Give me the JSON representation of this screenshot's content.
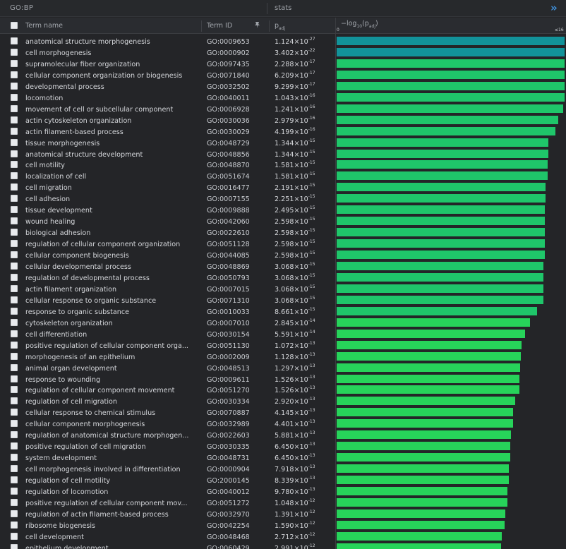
{
  "header": {
    "source": "GO:BP",
    "stats_label": "stats",
    "expand_glyph": "»"
  },
  "columns": {
    "term_name": "Term name",
    "term_id": "Term ID",
    "padj": "p",
    "padj_sub": "adj",
    "score_prefix": "−log",
    "score_sub": "10",
    "score_mid": "(p",
    "score_sub2": "adj",
    "score_suffix": ")",
    "scale_min": "0",
    "scale_max": "≤16"
  },
  "colors": {
    "bar_top": "#12939a",
    "bar_high": "#1fc66a",
    "bar_low": "#27d35a"
  },
  "rows": [
    {
      "name": "anatomical structure morphogenesis",
      "id": "GO:0009653",
      "mant": "1.124",
      "exp": "-27",
      "score": 26.95
    },
    {
      "name": "cell morphogenesis",
      "id": "GO:0000902",
      "mant": "3.402",
      "exp": "-22",
      "score": 21.47
    },
    {
      "name": "supramolecular fiber organization",
      "id": "GO:0097435",
      "mant": "2.288",
      "exp": "-17",
      "score": 16.64
    },
    {
      "name": "cellular component organization or biogenesis",
      "id": "GO:0071840",
      "mant": "6.209",
      "exp": "-17",
      "score": 16.21
    },
    {
      "name": "developmental process",
      "id": "GO:0032502",
      "mant": "9.299",
      "exp": "-17",
      "score": 16.03
    },
    {
      "name": "locomotion",
      "id": "GO:0040011",
      "mant": "1.043",
      "exp": "-16",
      "score": 15.98
    },
    {
      "name": "movement of cell or subcellular component",
      "id": "GO:0006928",
      "mant": "1.241",
      "exp": "-16",
      "score": 15.91
    },
    {
      "name": "actin cytoskeleton organization",
      "id": "GO:0030036",
      "mant": "2.979",
      "exp": "-16",
      "score": 15.53
    },
    {
      "name": "actin filament-based process",
      "id": "GO:0030029",
      "mant": "4.199",
      "exp": "-16",
      "score": 15.38
    },
    {
      "name": "tissue morphogenesis",
      "id": "GO:0048729",
      "mant": "1.344",
      "exp": "-15",
      "score": 14.87
    },
    {
      "name": "anatomical structure development",
      "id": "GO:0048856",
      "mant": "1.344",
      "exp": "-15",
      "score": 14.87
    },
    {
      "name": "cell motility",
      "id": "GO:0048870",
      "mant": "1.581",
      "exp": "-15",
      "score": 14.8
    },
    {
      "name": "localization of cell",
      "id": "GO:0051674",
      "mant": "1.581",
      "exp": "-15",
      "score": 14.8
    },
    {
      "name": "cell migration",
      "id": "GO:0016477",
      "mant": "2.191",
      "exp": "-15",
      "score": 14.66
    },
    {
      "name": "cell adhesion",
      "id": "GO:0007155",
      "mant": "2.251",
      "exp": "-15",
      "score": 14.65
    },
    {
      "name": "tissue development",
      "id": "GO:0009888",
      "mant": "2.495",
      "exp": "-15",
      "score": 14.6
    },
    {
      "name": "wound healing",
      "id": "GO:0042060",
      "mant": "2.598",
      "exp": "-15",
      "score": 14.59
    },
    {
      "name": "biological adhesion",
      "id": "GO:0022610",
      "mant": "2.598",
      "exp": "-15",
      "score": 14.59
    },
    {
      "name": "regulation of cellular component organization",
      "id": "GO:0051128",
      "mant": "2.598",
      "exp": "-15",
      "score": 14.59
    },
    {
      "name": "cellular component biogenesis",
      "id": "GO:0044085",
      "mant": "2.598",
      "exp": "-15",
      "score": 14.59
    },
    {
      "name": "cellular developmental process",
      "id": "GO:0048869",
      "mant": "3.068",
      "exp": "-15",
      "score": 14.51
    },
    {
      "name": "regulation of developmental process",
      "id": "GO:0050793",
      "mant": "3.068",
      "exp": "-15",
      "score": 14.51
    },
    {
      "name": "actin filament organization",
      "id": "GO:0007015",
      "mant": "3.068",
      "exp": "-15",
      "score": 14.51
    },
    {
      "name": "cellular response to organic substance",
      "id": "GO:0071310",
      "mant": "3.068",
      "exp": "-15",
      "score": 14.51
    },
    {
      "name": "response to organic substance",
      "id": "GO:0010033",
      "mant": "8.661",
      "exp": "-15",
      "score": 14.06
    },
    {
      "name": "cytoskeleton organization",
      "id": "GO:0007010",
      "mant": "2.845",
      "exp": "-14",
      "score": 13.55
    },
    {
      "name": "cell differentiation",
      "id": "GO:0030154",
      "mant": "5.591",
      "exp": "-14",
      "score": 13.25
    },
    {
      "name": "positive regulation of cellular component orga...",
      "id": "GO:0051130",
      "mant": "1.072",
      "exp": "-13",
      "score": 12.97
    },
    {
      "name": "morphogenesis of an epithelium",
      "id": "GO:0002009",
      "mant": "1.128",
      "exp": "-13",
      "score": 12.95
    },
    {
      "name": "animal organ development",
      "id": "GO:0048513",
      "mant": "1.297",
      "exp": "-13",
      "score": 12.89
    },
    {
      "name": "response to wounding",
      "id": "GO:0009611",
      "mant": "1.526",
      "exp": "-13",
      "score": 12.82
    },
    {
      "name": "regulation of cellular component movement",
      "id": "GO:0051270",
      "mant": "1.526",
      "exp": "-13",
      "score": 12.82
    },
    {
      "name": "regulation of cell migration",
      "id": "GO:0030334",
      "mant": "2.920",
      "exp": "-13",
      "score": 12.53
    },
    {
      "name": "cellular response to chemical stimulus",
      "id": "GO:0070887",
      "mant": "4.145",
      "exp": "-13",
      "score": 12.38
    },
    {
      "name": "cellular component morphogenesis",
      "id": "GO:0032989",
      "mant": "4.401",
      "exp": "-13",
      "score": 12.36
    },
    {
      "name": "regulation of anatomical structure morphogen...",
      "id": "GO:0022603",
      "mant": "5.881",
      "exp": "-13",
      "score": 12.23
    },
    {
      "name": "positive regulation of cell migration",
      "id": "GO:0030335",
      "mant": "6.450",
      "exp": "-13",
      "score": 12.19
    },
    {
      "name": "system development",
      "id": "GO:0048731",
      "mant": "6.450",
      "exp": "-13",
      "score": 12.19
    },
    {
      "name": "cell morphogenesis involved in differentiation",
      "id": "GO:0000904",
      "mant": "7.918",
      "exp": "-13",
      "score": 12.1
    },
    {
      "name": "regulation of cell motility",
      "id": "GO:2000145",
      "mant": "8.339",
      "exp": "-13",
      "score": 12.08
    },
    {
      "name": "regulation of locomotion",
      "id": "GO:0040012",
      "mant": "9.780",
      "exp": "-13",
      "score": 12.01
    },
    {
      "name": "positive regulation of cellular component mov...",
      "id": "GO:0051272",
      "mant": "1.048",
      "exp": "-12",
      "score": 11.98
    },
    {
      "name": "regulation of actin filament-based process",
      "id": "GO:0032970",
      "mant": "1.391",
      "exp": "-12",
      "score": 11.86
    },
    {
      "name": "ribosome biogenesis",
      "id": "GO:0042254",
      "mant": "1.590",
      "exp": "-12",
      "score": 11.8
    },
    {
      "name": "cell development",
      "id": "GO:0048468",
      "mant": "2.712",
      "exp": "-12",
      "score": 11.57
    },
    {
      "name": "epithelium development",
      "id": "GO:0060429",
      "mant": "2.991",
      "exp": "-12",
      "score": 11.52
    }
  ]
}
